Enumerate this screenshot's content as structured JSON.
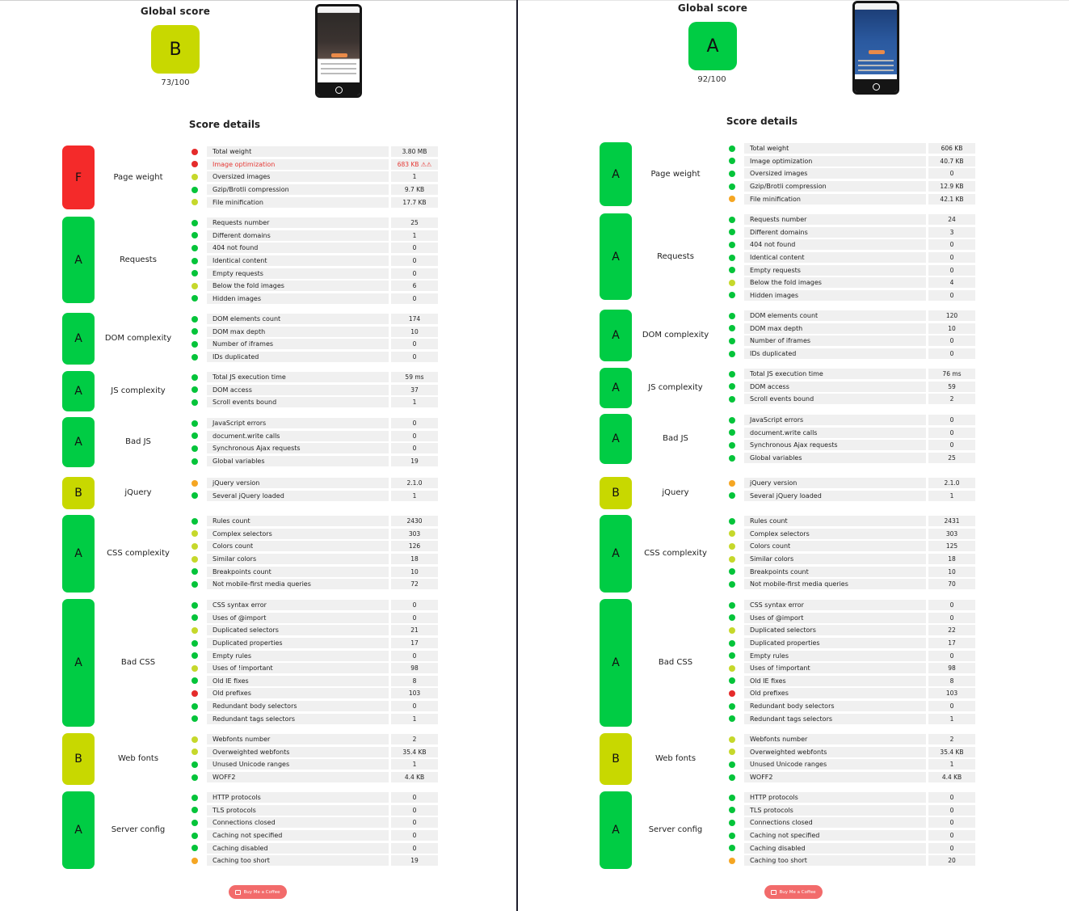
{
  "colors": {
    "grade_A": "#00cc44",
    "grade_B": "#c8d800",
    "grade_F": "#f42a2a",
    "status_green": "#05c43a",
    "status_yellow": "#c6d82b",
    "status_orange": "#f5a623",
    "status_red": "#e52b2b",
    "divider": "#1d1d2b"
  },
  "panels": [
    {
      "global_title": "Global score",
      "global_grade": "B",
      "global_value": "73/100",
      "details_title": "Score details",
      "coffee_label": "Buy Me a Coffee",
      "categories": [
        {
          "grade": "F",
          "name": "Page weight",
          "rows": [
            {
              "label": "Total weight",
              "value": "3.80 MB",
              "status": "red"
            },
            {
              "label": "Image optimization",
              "value": "683 KB ⚠⚠",
              "status": "red",
              "alert": true
            },
            {
              "label": "Oversized images",
              "value": "1",
              "status": "yellow"
            },
            {
              "label": "Gzip/Brotli compression",
              "value": "9.7 KB",
              "status": "green"
            },
            {
              "label": "File minification",
              "value": "17.7 KB",
              "status": "yellow"
            }
          ]
        },
        {
          "grade": "A",
          "name": "Requests",
          "rows": [
            {
              "label": "Requests number",
              "value": "25",
              "status": "green"
            },
            {
              "label": "Different domains",
              "value": "1",
              "status": "green"
            },
            {
              "label": "404 not found",
              "value": "0",
              "status": "green"
            },
            {
              "label": "Identical content",
              "value": "0",
              "status": "green"
            },
            {
              "label": "Empty requests",
              "value": "0",
              "status": "green"
            },
            {
              "label": "Below the fold images",
              "value": "6",
              "status": "yellow"
            },
            {
              "label": "Hidden images",
              "value": "0",
              "status": "green"
            }
          ]
        },
        {
          "grade": "A",
          "name": "DOM complexity",
          "rows": [
            {
              "label": "DOM elements count",
              "value": "174",
              "status": "green"
            },
            {
              "label": "DOM max depth",
              "value": "10",
              "status": "green"
            },
            {
              "label": "Number of iframes",
              "value": "0",
              "status": "green"
            },
            {
              "label": "IDs duplicated",
              "value": "0",
              "status": "green"
            }
          ]
        },
        {
          "grade": "A",
          "name": "JS complexity",
          "rows": [
            {
              "label": "Total JS execution time",
              "value": "59 ms",
              "status": "green"
            },
            {
              "label": "DOM access",
              "value": "37",
              "status": "green"
            },
            {
              "label": "Scroll events bound",
              "value": "1",
              "status": "green"
            }
          ]
        },
        {
          "grade": "A",
          "name": "Bad JS",
          "rows": [
            {
              "label": "JavaScript errors",
              "value": "0",
              "status": "green"
            },
            {
              "label": "document.write calls",
              "value": "0",
              "status": "green"
            },
            {
              "label": "Synchronous Ajax requests",
              "value": "0",
              "status": "green"
            },
            {
              "label": "Global variables",
              "value": "19",
              "status": "green"
            }
          ]
        },
        {
          "grade": "B",
          "name": "jQuery",
          "rows": [
            {
              "label": "jQuery version",
              "value": "2.1.0",
              "status": "orange"
            },
            {
              "label": "Several jQuery loaded",
              "value": "1",
              "status": "green"
            }
          ]
        },
        {
          "grade": "A",
          "name": "CSS complexity",
          "rows": [
            {
              "label": "Rules count",
              "value": "2430",
              "status": "green"
            },
            {
              "label": "Complex selectors",
              "value": "303",
              "status": "yellow"
            },
            {
              "label": "Colors count",
              "value": "126",
              "status": "yellow"
            },
            {
              "label": "Similar colors",
              "value": "18",
              "status": "yellow"
            },
            {
              "label": "Breakpoints count",
              "value": "10",
              "status": "green"
            },
            {
              "label": "Not mobile-first media queries",
              "value": "72",
              "status": "green"
            }
          ]
        },
        {
          "grade": "A",
          "name": "Bad CSS",
          "rows": [
            {
              "label": "CSS syntax error",
              "value": "0",
              "status": "green"
            },
            {
              "label": "Uses of @import",
              "value": "0",
              "status": "green"
            },
            {
              "label": "Duplicated selectors",
              "value": "21",
              "status": "yellow"
            },
            {
              "label": "Duplicated properties",
              "value": "17",
              "status": "green"
            },
            {
              "label": "Empty rules",
              "value": "0",
              "status": "green"
            },
            {
              "label": "Uses of !important",
              "value": "98",
              "status": "yellow"
            },
            {
              "label": "Old IE fixes",
              "value": "8",
              "status": "green"
            },
            {
              "label": "Old prefixes",
              "value": "103",
              "status": "red"
            },
            {
              "label": "Redundant body selectors",
              "value": "0",
              "status": "green"
            },
            {
              "label": "Redundant tags selectors",
              "value": "1",
              "status": "green"
            }
          ]
        },
        {
          "grade": "B",
          "name": "Web fonts",
          "rows": [
            {
              "label": "Webfonts number",
              "value": "2",
              "status": "yellow"
            },
            {
              "label": "Overweighted webfonts",
              "value": "35.4 KB",
              "status": "yellow"
            },
            {
              "label": "Unused Unicode ranges",
              "value": "1",
              "status": "green"
            },
            {
              "label": "WOFF2",
              "value": "4.4 KB",
              "status": "green"
            }
          ]
        },
        {
          "grade": "A",
          "name": "Server config",
          "rows": [
            {
              "label": "HTTP protocols",
              "value": "0",
              "status": "green"
            },
            {
              "label": "TLS protocols",
              "value": "0",
              "status": "green"
            },
            {
              "label": "Connections closed",
              "value": "0",
              "status": "green"
            },
            {
              "label": "Caching not specified",
              "value": "0",
              "status": "green"
            },
            {
              "label": "Caching disabled",
              "value": "0",
              "status": "green"
            },
            {
              "label": "Caching too short",
              "value": "19",
              "status": "orange"
            }
          ]
        }
      ]
    },
    {
      "global_title": "Global score",
      "global_grade": "A",
      "global_value": "92/100",
      "details_title": "Score details",
      "coffee_label": "Buy Me a Coffee",
      "categories": [
        {
          "grade": "A",
          "name": "Page weight",
          "rows": [
            {
              "label": "Total weight",
              "value": "606 KB",
              "status": "green"
            },
            {
              "label": "Image optimization",
              "value": "40.7 KB",
              "status": "green"
            },
            {
              "label": "Oversized images",
              "value": "0",
              "status": "green"
            },
            {
              "label": "Gzip/Brotli compression",
              "value": "12.9 KB",
              "status": "green"
            },
            {
              "label": "File minification",
              "value": "42.1 KB",
              "status": "orange"
            }
          ]
        },
        {
          "grade": "A",
          "name": "Requests",
          "rows": [
            {
              "label": "Requests number",
              "value": "24",
              "status": "green"
            },
            {
              "label": "Different domains",
              "value": "3",
              "status": "green"
            },
            {
              "label": "404 not found",
              "value": "0",
              "status": "green"
            },
            {
              "label": "Identical content",
              "value": "0",
              "status": "green"
            },
            {
              "label": "Empty requests",
              "value": "0",
              "status": "green"
            },
            {
              "label": "Below the fold images",
              "value": "4",
              "status": "yellow"
            },
            {
              "label": "Hidden images",
              "value": "0",
              "status": "green"
            }
          ]
        },
        {
          "grade": "A",
          "name": "DOM complexity",
          "rows": [
            {
              "label": "DOM elements count",
              "value": "120",
              "status": "green"
            },
            {
              "label": "DOM max depth",
              "value": "10",
              "status": "green"
            },
            {
              "label": "Number of iframes",
              "value": "0",
              "status": "green"
            },
            {
              "label": "IDs duplicated",
              "value": "0",
              "status": "green"
            }
          ]
        },
        {
          "grade": "A",
          "name": "JS complexity",
          "rows": [
            {
              "label": "Total JS execution time",
              "value": "76 ms",
              "status": "green"
            },
            {
              "label": "DOM access",
              "value": "59",
              "status": "green"
            },
            {
              "label": "Scroll events bound",
              "value": "2",
              "status": "green"
            }
          ]
        },
        {
          "grade": "A",
          "name": "Bad JS",
          "rows": [
            {
              "label": "JavaScript errors",
              "value": "0",
              "status": "green"
            },
            {
              "label": "document.write calls",
              "value": "0",
              "status": "green"
            },
            {
              "label": "Synchronous Ajax requests",
              "value": "0",
              "status": "green"
            },
            {
              "label": "Global variables",
              "value": "25",
              "status": "green"
            }
          ]
        },
        {
          "grade": "B",
          "name": "jQuery",
          "rows": [
            {
              "label": "jQuery version",
              "value": "2.1.0",
              "status": "orange"
            },
            {
              "label": "Several jQuery loaded",
              "value": "1",
              "status": "green"
            }
          ]
        },
        {
          "grade": "A",
          "name": "CSS complexity",
          "rows": [
            {
              "label": "Rules count",
              "value": "2431",
              "status": "green"
            },
            {
              "label": "Complex selectors",
              "value": "303",
              "status": "yellow"
            },
            {
              "label": "Colors count",
              "value": "125",
              "status": "yellow"
            },
            {
              "label": "Similar colors",
              "value": "18",
              "status": "yellow"
            },
            {
              "label": "Breakpoints count",
              "value": "10",
              "status": "green"
            },
            {
              "label": "Not mobile-first media queries",
              "value": "70",
              "status": "green"
            }
          ]
        },
        {
          "grade": "A",
          "name": "Bad CSS",
          "rows": [
            {
              "label": "CSS syntax error",
              "value": "0",
              "status": "green"
            },
            {
              "label": "Uses of @import",
              "value": "0",
              "status": "green"
            },
            {
              "label": "Duplicated selectors",
              "value": "22",
              "status": "yellow"
            },
            {
              "label": "Duplicated properties",
              "value": "17",
              "status": "green"
            },
            {
              "label": "Empty rules",
              "value": "0",
              "status": "green"
            },
            {
              "label": "Uses of !important",
              "value": "98",
              "status": "yellow"
            },
            {
              "label": "Old IE fixes",
              "value": "8",
              "status": "green"
            },
            {
              "label": "Old prefixes",
              "value": "103",
              "status": "red"
            },
            {
              "label": "Redundant body selectors",
              "value": "0",
              "status": "green"
            },
            {
              "label": "Redundant tags selectors",
              "value": "1",
              "status": "green"
            }
          ]
        },
        {
          "grade": "B",
          "name": "Web fonts",
          "rows": [
            {
              "label": "Webfonts number",
              "value": "2",
              "status": "yellow"
            },
            {
              "label": "Overweighted webfonts",
              "value": "35.4 KB",
              "status": "yellow"
            },
            {
              "label": "Unused Unicode ranges",
              "value": "1",
              "status": "green"
            },
            {
              "label": "WOFF2",
              "value": "4.4 KB",
              "status": "green"
            }
          ]
        },
        {
          "grade": "A",
          "name": "Server config",
          "rows": [
            {
              "label": "HTTP protocols",
              "value": "0",
              "status": "green"
            },
            {
              "label": "TLS protocols",
              "value": "0",
              "status": "green"
            },
            {
              "label": "Connections closed",
              "value": "0",
              "status": "green"
            },
            {
              "label": "Caching not specified",
              "value": "0",
              "status": "green"
            },
            {
              "label": "Caching disabled",
              "value": "0",
              "status": "green"
            },
            {
              "label": "Caching too short",
              "value": "20",
              "status": "orange"
            }
          ]
        }
      ]
    }
  ]
}
